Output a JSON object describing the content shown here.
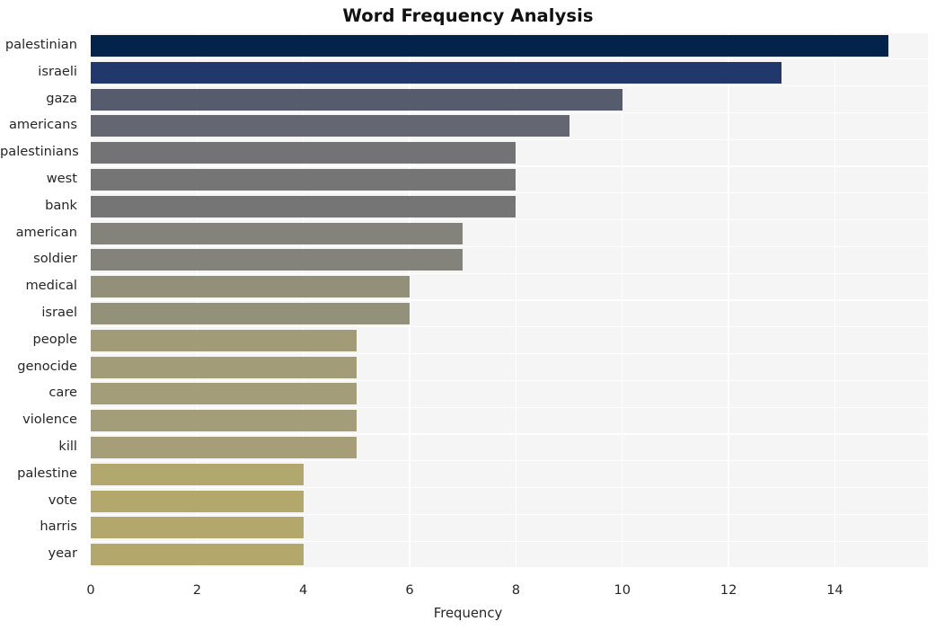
{
  "chart_data": {
    "type": "bar",
    "orientation": "horizontal",
    "title": "Word Frequency Analysis",
    "xlabel": "Frequency",
    "ylabel": "",
    "categories": [
      "palestinian",
      "israeli",
      "gaza",
      "americans",
      "palestinians",
      "west",
      "bank",
      "american",
      "soldier",
      "medical",
      "israel",
      "people",
      "genocide",
      "care",
      "violence",
      "kill",
      "palestine",
      "vote",
      "harris",
      "year"
    ],
    "values": [
      15,
      13,
      10,
      9,
      8,
      8,
      8,
      7,
      7,
      6,
      6,
      5,
      5,
      5,
      5,
      5,
      4,
      4,
      4,
      4
    ],
    "bar_colors": [
      "#04234a",
      "#21386c",
      "#565c6e",
      "#646771",
      "#737375",
      "#757575",
      "#757575",
      "#83827b",
      "#84837b",
      "#93907a",
      "#94917a",
      "#a29b78",
      "#a39c78",
      "#a49d79",
      "#a49d79",
      "#a59e79",
      "#b2a76c",
      "#b3a76b",
      "#b3a76b",
      "#b3a76b"
    ],
    "xticks": [
      0,
      2,
      4,
      6,
      8,
      10,
      12,
      14
    ],
    "xtick_labels": [
      "0",
      "2",
      "4",
      "6",
      "8",
      "10",
      "12",
      "14"
    ],
    "xlim": [
      0,
      15.75
    ],
    "ylim_categories": 20,
    "grid": true,
    "grid_color": "#ffffff",
    "plot_background": "#f5f5f5",
    "figure_background": "#ffffff",
    "legend": null
  }
}
